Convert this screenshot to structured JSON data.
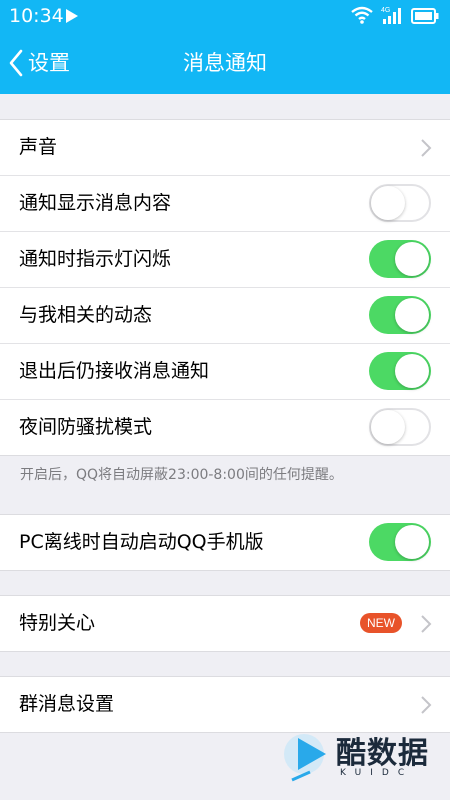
{
  "status_bar": {
    "time": "10:34",
    "network": "4G"
  },
  "nav": {
    "back_label": "设置",
    "title": "消息通知"
  },
  "groups": {
    "main": [
      {
        "label": "声音",
        "control": "chevron"
      },
      {
        "label": "通知显示消息内容",
        "control": "toggle",
        "on": false
      },
      {
        "label": "通知时指示灯闪烁",
        "control": "toggle",
        "on": true
      },
      {
        "label": "与我相关的动态",
        "control": "toggle",
        "on": true
      },
      {
        "label": "退出后仍接收消息通知",
        "control": "toggle",
        "on": true
      },
      {
        "label": "夜间防骚扰模式",
        "control": "toggle",
        "on": false
      }
    ],
    "night_note": "开启后，QQ将自动屏蔽23:00-8:00间的任何提醒。",
    "pc": [
      {
        "label": "PC离线时自动启动QQ手机版",
        "control": "toggle",
        "on": true
      }
    ],
    "special": [
      {
        "label": "特别关心",
        "control": "chevron",
        "badge": "NEW"
      }
    ],
    "group_msg": [
      {
        "label": "群消息设置",
        "control": "chevron"
      }
    ]
  },
  "watermark": {
    "text": "酷数据",
    "sub": "KUIDC"
  },
  "colors": {
    "header": "#12b7f5",
    "toggle_on": "#4cd964",
    "badge": "#e8532a",
    "background": "#efeff4"
  },
  "icons": {
    "back": "chevron-left-icon",
    "row_arrow": "chevron-right-icon",
    "play": "play-icon",
    "wifi": "wifi-icon",
    "signal": "signal-icon",
    "battery": "battery-icon"
  }
}
